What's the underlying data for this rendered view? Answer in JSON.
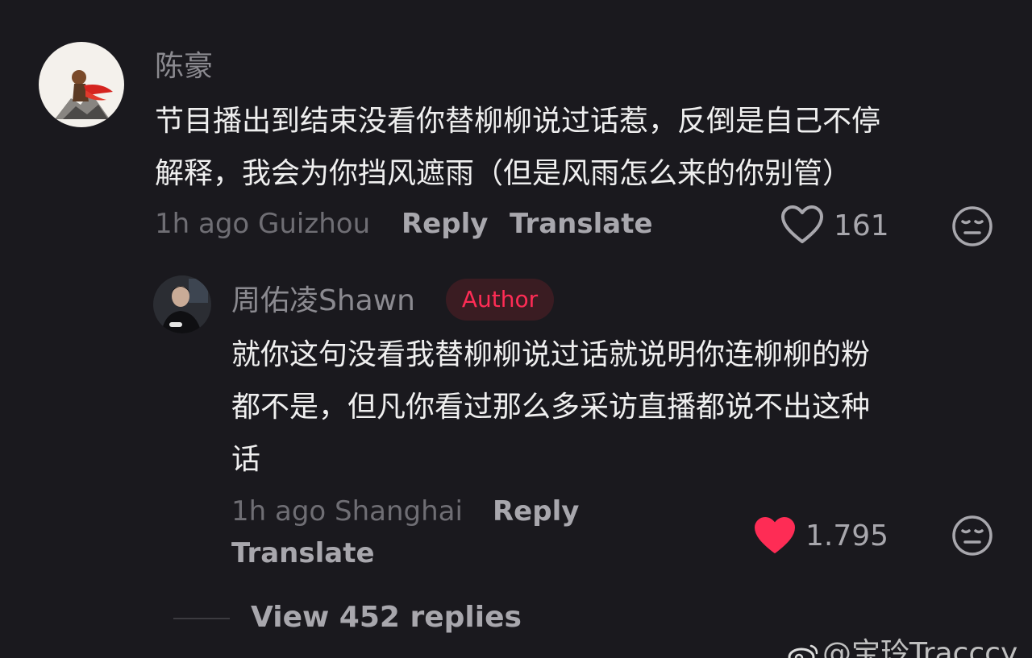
{
  "comment": {
    "username": "陈豪",
    "text_lines": [
      "节目播出到结束没看你替柳柳说过话惹，反倒是自己不停",
      "解释，我会为你挡风遮雨（但是风雨怎么来的你别管）"
    ],
    "time": "1h ago",
    "location": "Guizhou",
    "reply_label": "Reply",
    "translate_label": "Translate",
    "like_count": "161",
    "liked": false,
    "like_icon": "heart-outline-icon",
    "dislike_icon": "meh-face-icon"
  },
  "reply": {
    "username": "周佑凌Shawn",
    "badge": "Author",
    "text_lines": [
      "就你这句没看我替柳柳说过话就说明你连柳柳的粉",
      "都不是，但凡你看过那么多采访直播都说不出这种",
      "话"
    ],
    "time": "1h ago",
    "location": "Shanghai",
    "reply_label": "Reply",
    "translate_label": "Translate",
    "like_count": "1.795",
    "liked": true,
    "like_icon": "heart-filled-icon",
    "dislike_icon": "meh-face-icon"
  },
  "view_replies": "View 452 replies",
  "watermark": "@宝玲Tracccy",
  "colors": {
    "background": "#1a191e",
    "accent": "#fe2c55",
    "like_red": "#fe2c55",
    "muted_text": "#6f6e74",
    "action_text": "#a8a7ad"
  }
}
